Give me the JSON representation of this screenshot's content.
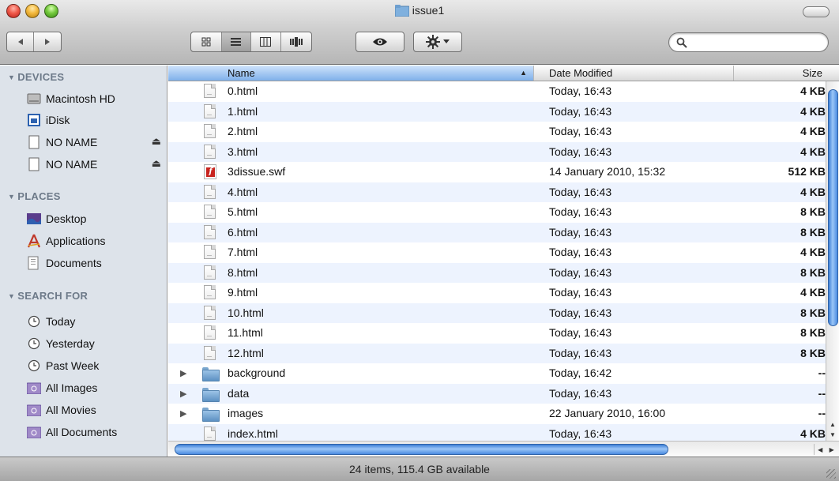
{
  "window": {
    "title": "issue1"
  },
  "toolbar": {
    "back_icon": "back-arrow-icon",
    "forward_icon": "forward-arrow-icon",
    "view_modes": [
      "icon-view",
      "list-view",
      "column-view",
      "coverflow-view"
    ],
    "active_view": "list-view",
    "quicklook_icon": "eye-icon",
    "action_icon": "gear-icon",
    "search_placeholder": ""
  },
  "sidebar": {
    "devices_header": "DEVICES",
    "devices": [
      {
        "label": "Macintosh HD",
        "icon": "hard-drive-icon",
        "eject": false
      },
      {
        "label": "iDisk",
        "icon": "idisk-icon",
        "eject": false
      },
      {
        "label": "NO NAME",
        "icon": "removable-disk-icon",
        "eject": true
      },
      {
        "label": "NO NAME",
        "icon": "removable-disk-icon",
        "eject": true
      }
    ],
    "places_header": "PLACES",
    "places": [
      {
        "label": "Desktop",
        "icon": "desktop-icon"
      },
      {
        "label": "Applications",
        "icon": "applications-icon"
      },
      {
        "label": "Documents",
        "icon": "documents-icon"
      }
    ],
    "search_header": "SEARCH FOR",
    "searches": [
      {
        "label": "Today",
        "icon": "clock-icon"
      },
      {
        "label": "Yesterday",
        "icon": "clock-icon"
      },
      {
        "label": "Past Week",
        "icon": "clock-icon"
      },
      {
        "label": "All Images",
        "icon": "smart-folder-icon"
      },
      {
        "label": "All Movies",
        "icon": "smart-folder-icon"
      },
      {
        "label": "All Documents",
        "icon": "smart-folder-icon"
      }
    ],
    "eject_glyph": "⏏"
  },
  "columns": {
    "name": "Name",
    "date": "Date Modified",
    "size": "Size",
    "sort_arrow": "▲"
  },
  "files": [
    {
      "name": "0.html",
      "date": "Today, 16:43",
      "size": "4 KB",
      "kind": "doc"
    },
    {
      "name": "1.html",
      "date": "Today, 16:43",
      "size": "4 KB",
      "kind": "doc"
    },
    {
      "name": "2.html",
      "date": "Today, 16:43",
      "size": "4 KB",
      "kind": "doc"
    },
    {
      "name": "3.html",
      "date": "Today, 16:43",
      "size": "4 KB",
      "kind": "doc"
    },
    {
      "name": "3dissue.swf",
      "date": "14 January 2010, 15:32",
      "size": "512 KB",
      "kind": "swf"
    },
    {
      "name": "4.html",
      "date": "Today, 16:43",
      "size": "4 KB",
      "kind": "doc"
    },
    {
      "name": "5.html",
      "date": "Today, 16:43",
      "size": "8 KB",
      "kind": "doc"
    },
    {
      "name": "6.html",
      "date": "Today, 16:43",
      "size": "8 KB",
      "kind": "doc"
    },
    {
      "name": "7.html",
      "date": "Today, 16:43",
      "size": "4 KB",
      "kind": "doc"
    },
    {
      "name": "8.html",
      "date": "Today, 16:43",
      "size": "8 KB",
      "kind": "doc"
    },
    {
      "name": "9.html",
      "date": "Today, 16:43",
      "size": "4 KB",
      "kind": "doc"
    },
    {
      "name": "10.html",
      "date": "Today, 16:43",
      "size": "8 KB",
      "kind": "doc"
    },
    {
      "name": "11.html",
      "date": "Today, 16:43",
      "size": "8 KB",
      "kind": "doc"
    },
    {
      "name": "12.html",
      "date": "Today, 16:43",
      "size": "8 KB",
      "kind": "doc"
    },
    {
      "name": "background",
      "date": "Today, 16:42",
      "size": "--",
      "kind": "folder"
    },
    {
      "name": "data",
      "date": "Today, 16:43",
      "size": "--",
      "kind": "folder"
    },
    {
      "name": "images",
      "date": "22 January 2010, 16:00",
      "size": "--",
      "kind": "folder"
    },
    {
      "name": "index.html",
      "date": "Today, 16:43",
      "size": "4 KB",
      "kind": "doc"
    }
  ],
  "status": {
    "text": "24 items, 115.4 GB available"
  }
}
